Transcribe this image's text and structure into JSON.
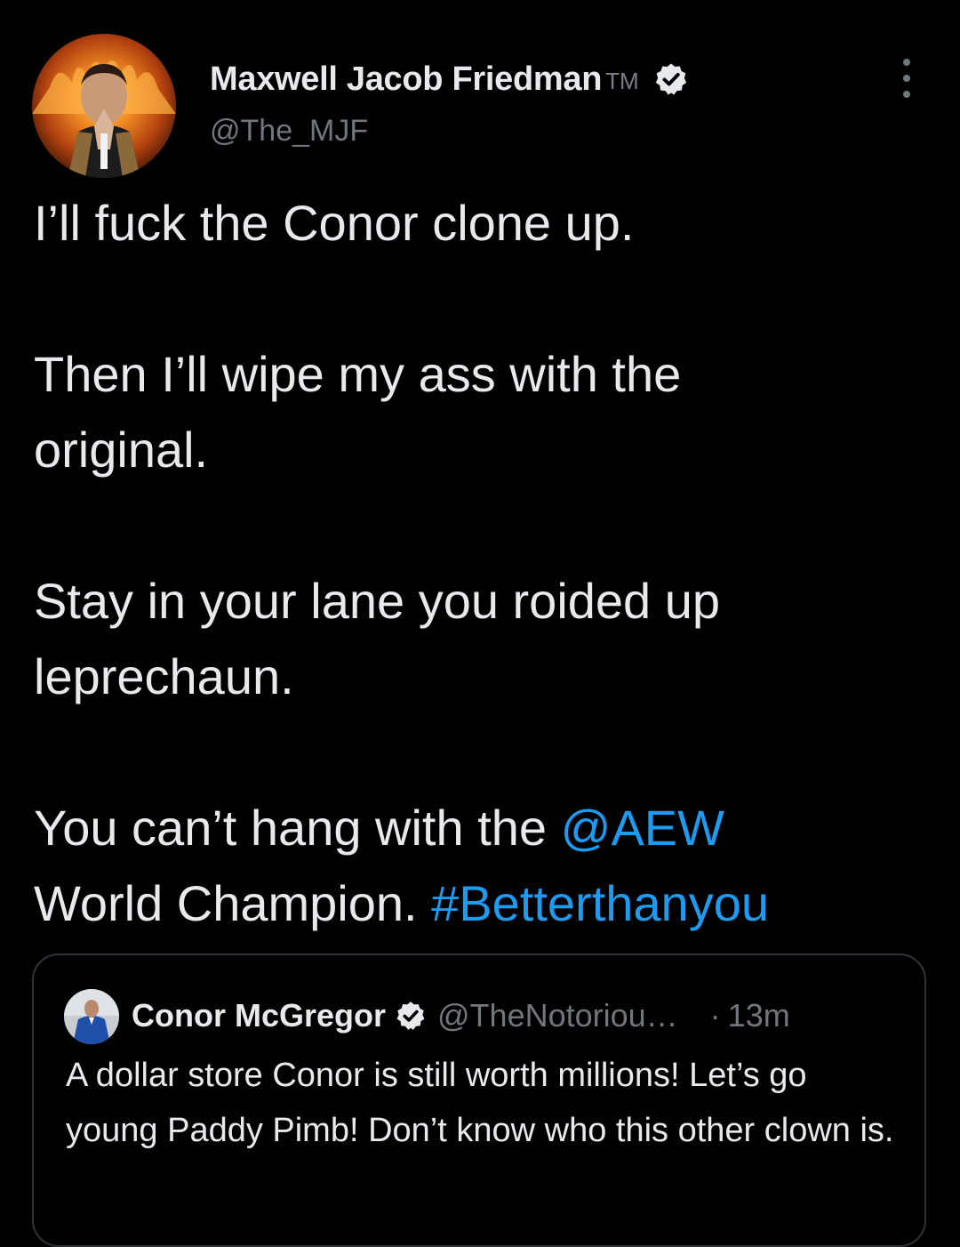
{
  "tweet": {
    "author": {
      "name": "Maxwell Jacob Friedman",
      "trademark": "TM",
      "handle": "@The_MJF",
      "verified": true
    },
    "paragraphs": [
      {
        "text": "I’ll fuck the Conor clone up."
      },
      {
        "text": "Then I’ll wipe my ass with the original."
      },
      {
        "text": "Stay in your lane you roided up leprechaun."
      }
    ],
    "last_paragraph": {
      "before_mention": "You can’t hang with the ",
      "mention": "@AEW",
      "after_mention": " World Champion. ",
      "hashtag": "#Betterthanyou"
    },
    "more_icon": "more-horizontal-icon"
  },
  "quoted_tweet": {
    "author_name": "Conor McGregor",
    "verified": true,
    "handle": "@TheNotoriou…",
    "separator": "·",
    "time": "13m",
    "text": "A dollar store Conor is still worth millions! Let’s go young Paddy Pimb! Don’t know who this other clown is."
  },
  "colors": {
    "background": "#000000",
    "text": "#e7e9ea",
    "secondary": "#71767b",
    "link": "#1d9bf0",
    "border": "#2f3336",
    "verified_badge": "#e7e9ea"
  }
}
